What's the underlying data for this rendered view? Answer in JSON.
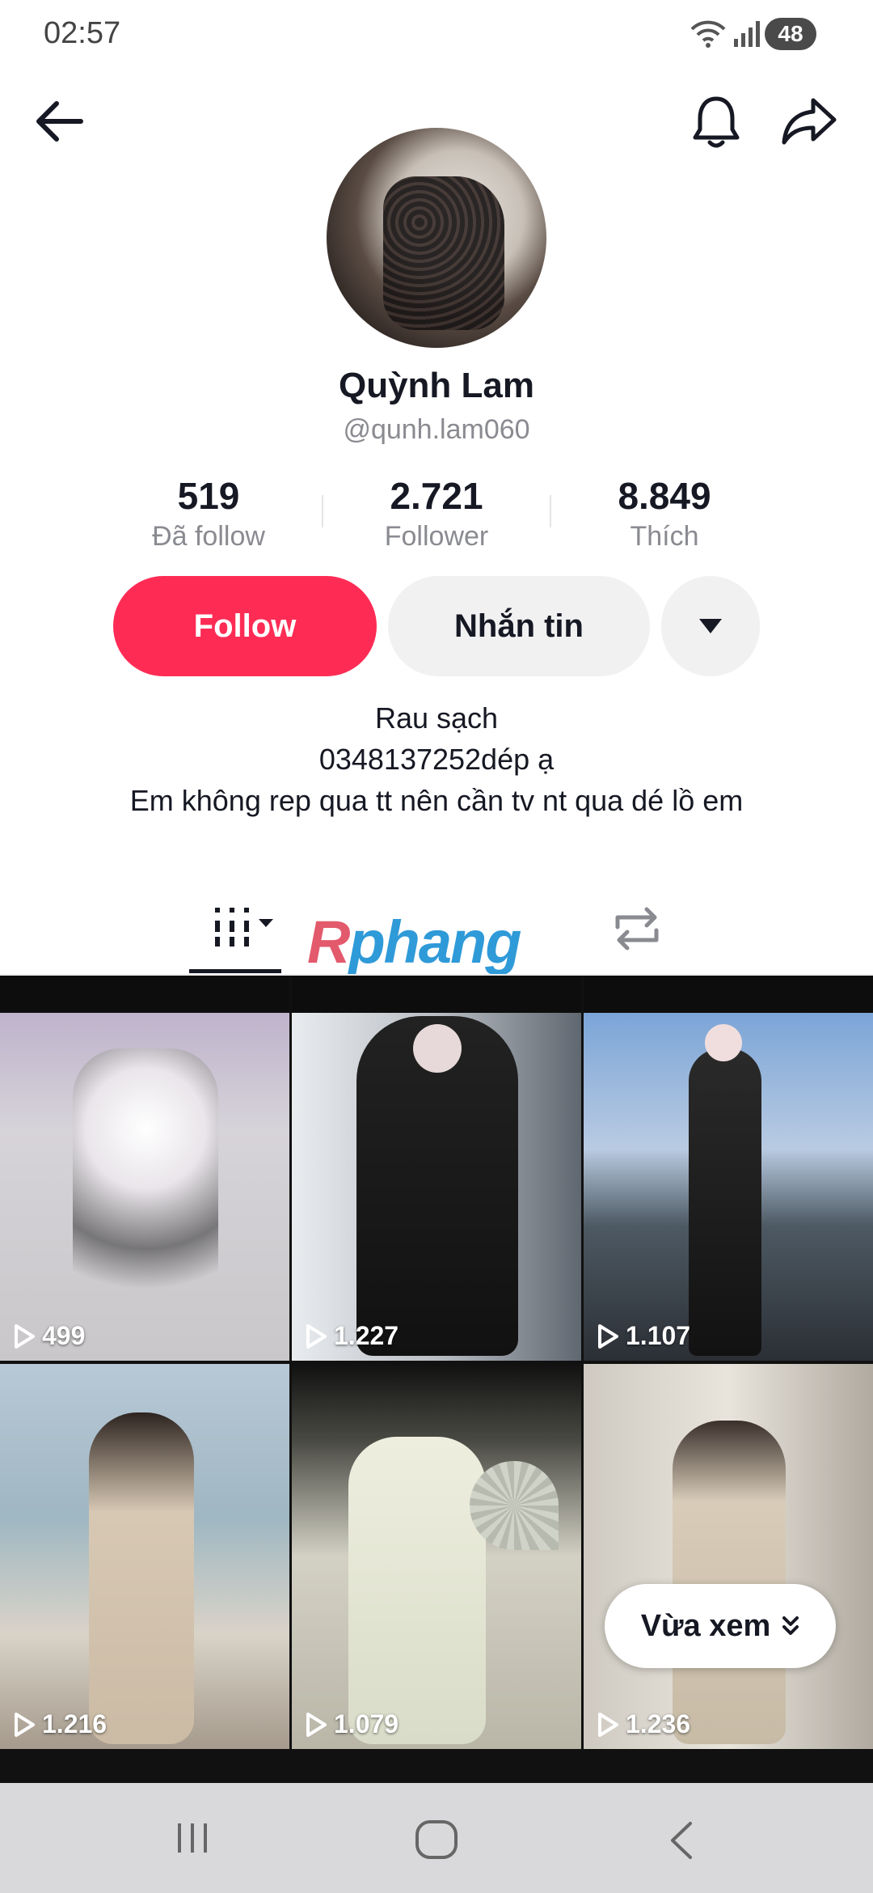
{
  "status": {
    "time": "02:57",
    "battery": "48"
  },
  "profile": {
    "name": "Quỳnh Lam",
    "handle": "@qunh.lam060",
    "stats": [
      {
        "value": "519",
        "label": "Đã follow"
      },
      {
        "value": "2.721",
        "label": "Follower"
      },
      {
        "value": "8.849",
        "label": "Thích"
      }
    ],
    "follow_label": "Follow",
    "message_label": "Nhắn tin",
    "bio": [
      "Rau sạch",
      "0348137252dép ạ",
      "Em không rep qua tt nên cần tv nt qua dé lồ em"
    ]
  },
  "watermark": {
    "r": "R",
    "rest": "phang"
  },
  "videos": [
    {
      "views": "499"
    },
    {
      "views": "1.227"
    },
    {
      "views": "1.107"
    },
    {
      "views": "1.216"
    },
    {
      "views": "1.079"
    },
    {
      "views": "1.236"
    }
  ],
  "recently_viewed_label": "Vừa xem",
  "icons": [
    "arrow-left-icon",
    "bell-icon",
    "share-icon",
    "caret-down-icon",
    "grid-icon",
    "repost-icon",
    "play-icon",
    "double-chevron-down-icon",
    "recent-apps-icon",
    "home-icon",
    "back-nav-icon"
  ],
  "colors": {
    "accent": "#fe2c55",
    "button_gray": "#f1f1f2",
    "muted_text": "#8a8b91"
  }
}
